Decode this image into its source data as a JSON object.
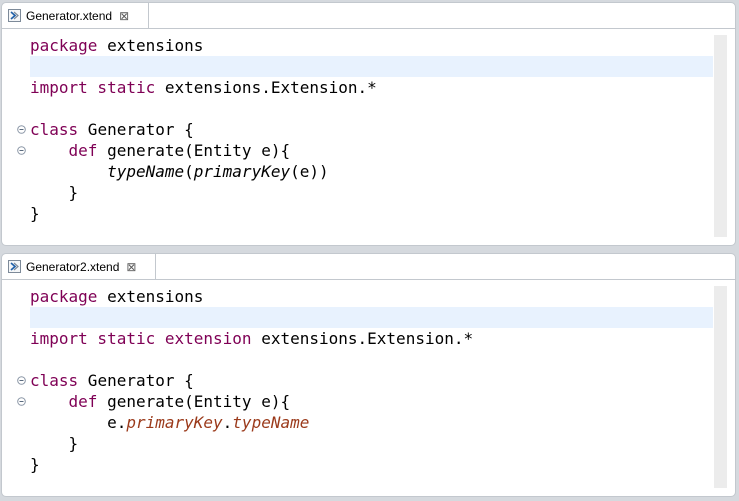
{
  "editors": [
    {
      "tab": {
        "title": "Generator.xtend",
        "close_glyph": "⊠"
      },
      "lines": {
        "l1_kw": "package",
        "l1_rest": " extensions",
        "l3_kw": "import static",
        "l3_rest": " extensions.Extension.*",
        "l5_kw": "class",
        "l5_rest": " Generator {",
        "l6_indent": "    ",
        "l6_kw": "def",
        "l6_rest": " generate(Entity e){",
        "l7_indent": "        ",
        "l7_a": "typeName",
        "l7_b": "(",
        "l7_c": "primaryKey",
        "l7_d": "(e))",
        "l8": "    }",
        "l9": "}"
      }
    },
    {
      "tab": {
        "title": "Generator2.xtend",
        "close_glyph": "⊠"
      },
      "lines": {
        "l1_kw": "package",
        "l1_rest": " extensions",
        "l3_kw": "import static extension",
        "l3_rest": " extensions.Extension.*",
        "l5_kw": "class",
        "l5_rest": " Generator {",
        "l6_indent": "    ",
        "l6_kw": "def",
        "l6_rest": " generate(Entity e){",
        "l7_indent": "        ",
        "l7_a": "e.",
        "l7_b": "primaryKey",
        "l7_c": ".",
        "l7_d": "typeName",
        "l8": "    }",
        "l9": "}"
      }
    }
  ],
  "colors": {
    "keyword": "#7f0055",
    "extension_call": "#9b3a1b",
    "current_line": "#e8f2fe"
  },
  "icons": {
    "file": "xtend-file-icon",
    "close": "close-icon",
    "fold": "fold-minus-icon"
  }
}
